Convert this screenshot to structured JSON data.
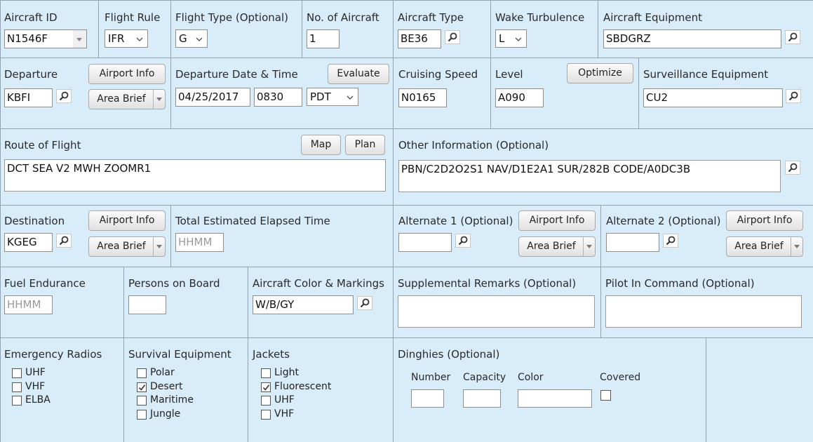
{
  "row1": {
    "aircraft_id": {
      "label": "Aircraft ID",
      "value": "N1546F"
    },
    "flight_rule": {
      "label": "Flight Rule",
      "value": "IFR"
    },
    "flight_type": {
      "label": "Flight Type (Optional)",
      "value": "G"
    },
    "num_aircraft": {
      "label": "No. of Aircraft",
      "value": "1"
    },
    "aircraft_type": {
      "label": "Aircraft Type",
      "value": "BE36"
    },
    "wake_turbulence": {
      "label": "Wake Turbulence",
      "value": "L"
    },
    "aircraft_equipment": {
      "label": "Aircraft Equipment",
      "value": "SBDGRZ"
    }
  },
  "row2": {
    "departure": {
      "label": "Departure",
      "value": "KBFI",
      "airport_info": "Airport Info",
      "area_brief": "Area Brief"
    },
    "departure_dt": {
      "label": "Departure Date & Time",
      "date": "04/25/2017",
      "time": "0830",
      "tz": "PDT",
      "evaluate": "Evaluate"
    },
    "cruising_speed": {
      "label": "Cruising Speed",
      "value": "N0165"
    },
    "level": {
      "label": "Level",
      "value": "A090",
      "optimize": "Optimize"
    },
    "surveillance": {
      "label": "Surveillance Equipment",
      "value": "CU2"
    }
  },
  "row3": {
    "route": {
      "label": "Route of Flight",
      "value": "DCT SEA V2 MWH ZOOMR1",
      "map": "Map",
      "plan": "Plan"
    },
    "other_info": {
      "label": "Other Information (Optional)",
      "value": "PBN/C2D2O2S1 NAV/D1E2A1 SUR/282B CODE/A0DC3B"
    }
  },
  "row4": {
    "destination": {
      "label": "Destination",
      "value": "KGEG",
      "airport_info": "Airport Info",
      "area_brief": "Area Brief"
    },
    "total_ete": {
      "label": "Total Estimated Elapsed Time",
      "placeholder": "HHMM"
    },
    "alternate1": {
      "label": "Alternate 1 (Optional)",
      "value": "",
      "airport_info": "Airport Info",
      "area_brief": "Area Brief"
    },
    "alternate2": {
      "label": "Alternate 2 (Optional)",
      "value": "",
      "airport_info": "Airport Info",
      "area_brief": "Area Brief"
    }
  },
  "row5": {
    "fuel": {
      "label": "Fuel Endurance",
      "placeholder": "HHMM"
    },
    "persons": {
      "label": "Persons on Board",
      "value": ""
    },
    "color_markings": {
      "label": "Aircraft Color & Markings",
      "value": "W/B/GY"
    },
    "supplemental": {
      "label": "Supplemental Remarks (Optional)",
      "value": ""
    },
    "pic": {
      "label": "Pilot In Command (Optional)",
      "value": ""
    }
  },
  "row6": {
    "radios": {
      "label": "Emergency Radios",
      "items": [
        {
          "label": "UHF",
          "checked": false
        },
        {
          "label": "VHF",
          "checked": false
        },
        {
          "label": "ELBA",
          "checked": false
        }
      ]
    },
    "survival": {
      "label": "Survival Equipment",
      "items": [
        {
          "label": "Polar",
          "checked": false
        },
        {
          "label": "Desert",
          "checked": true
        },
        {
          "label": "Maritime",
          "checked": false
        },
        {
          "label": "Jungle",
          "checked": false
        }
      ]
    },
    "jackets": {
      "label": "Jackets",
      "items": [
        {
          "label": "Light",
          "checked": false
        },
        {
          "label": "Fluorescent",
          "checked": true
        },
        {
          "label": "UHF",
          "checked": false
        },
        {
          "label": "VHF",
          "checked": false
        }
      ]
    },
    "dinghies": {
      "label": "Dinghies (Optional)",
      "number": "Number",
      "capacity": "Capacity",
      "color": "Color",
      "covered": "Covered",
      "covered_checked": false
    }
  }
}
